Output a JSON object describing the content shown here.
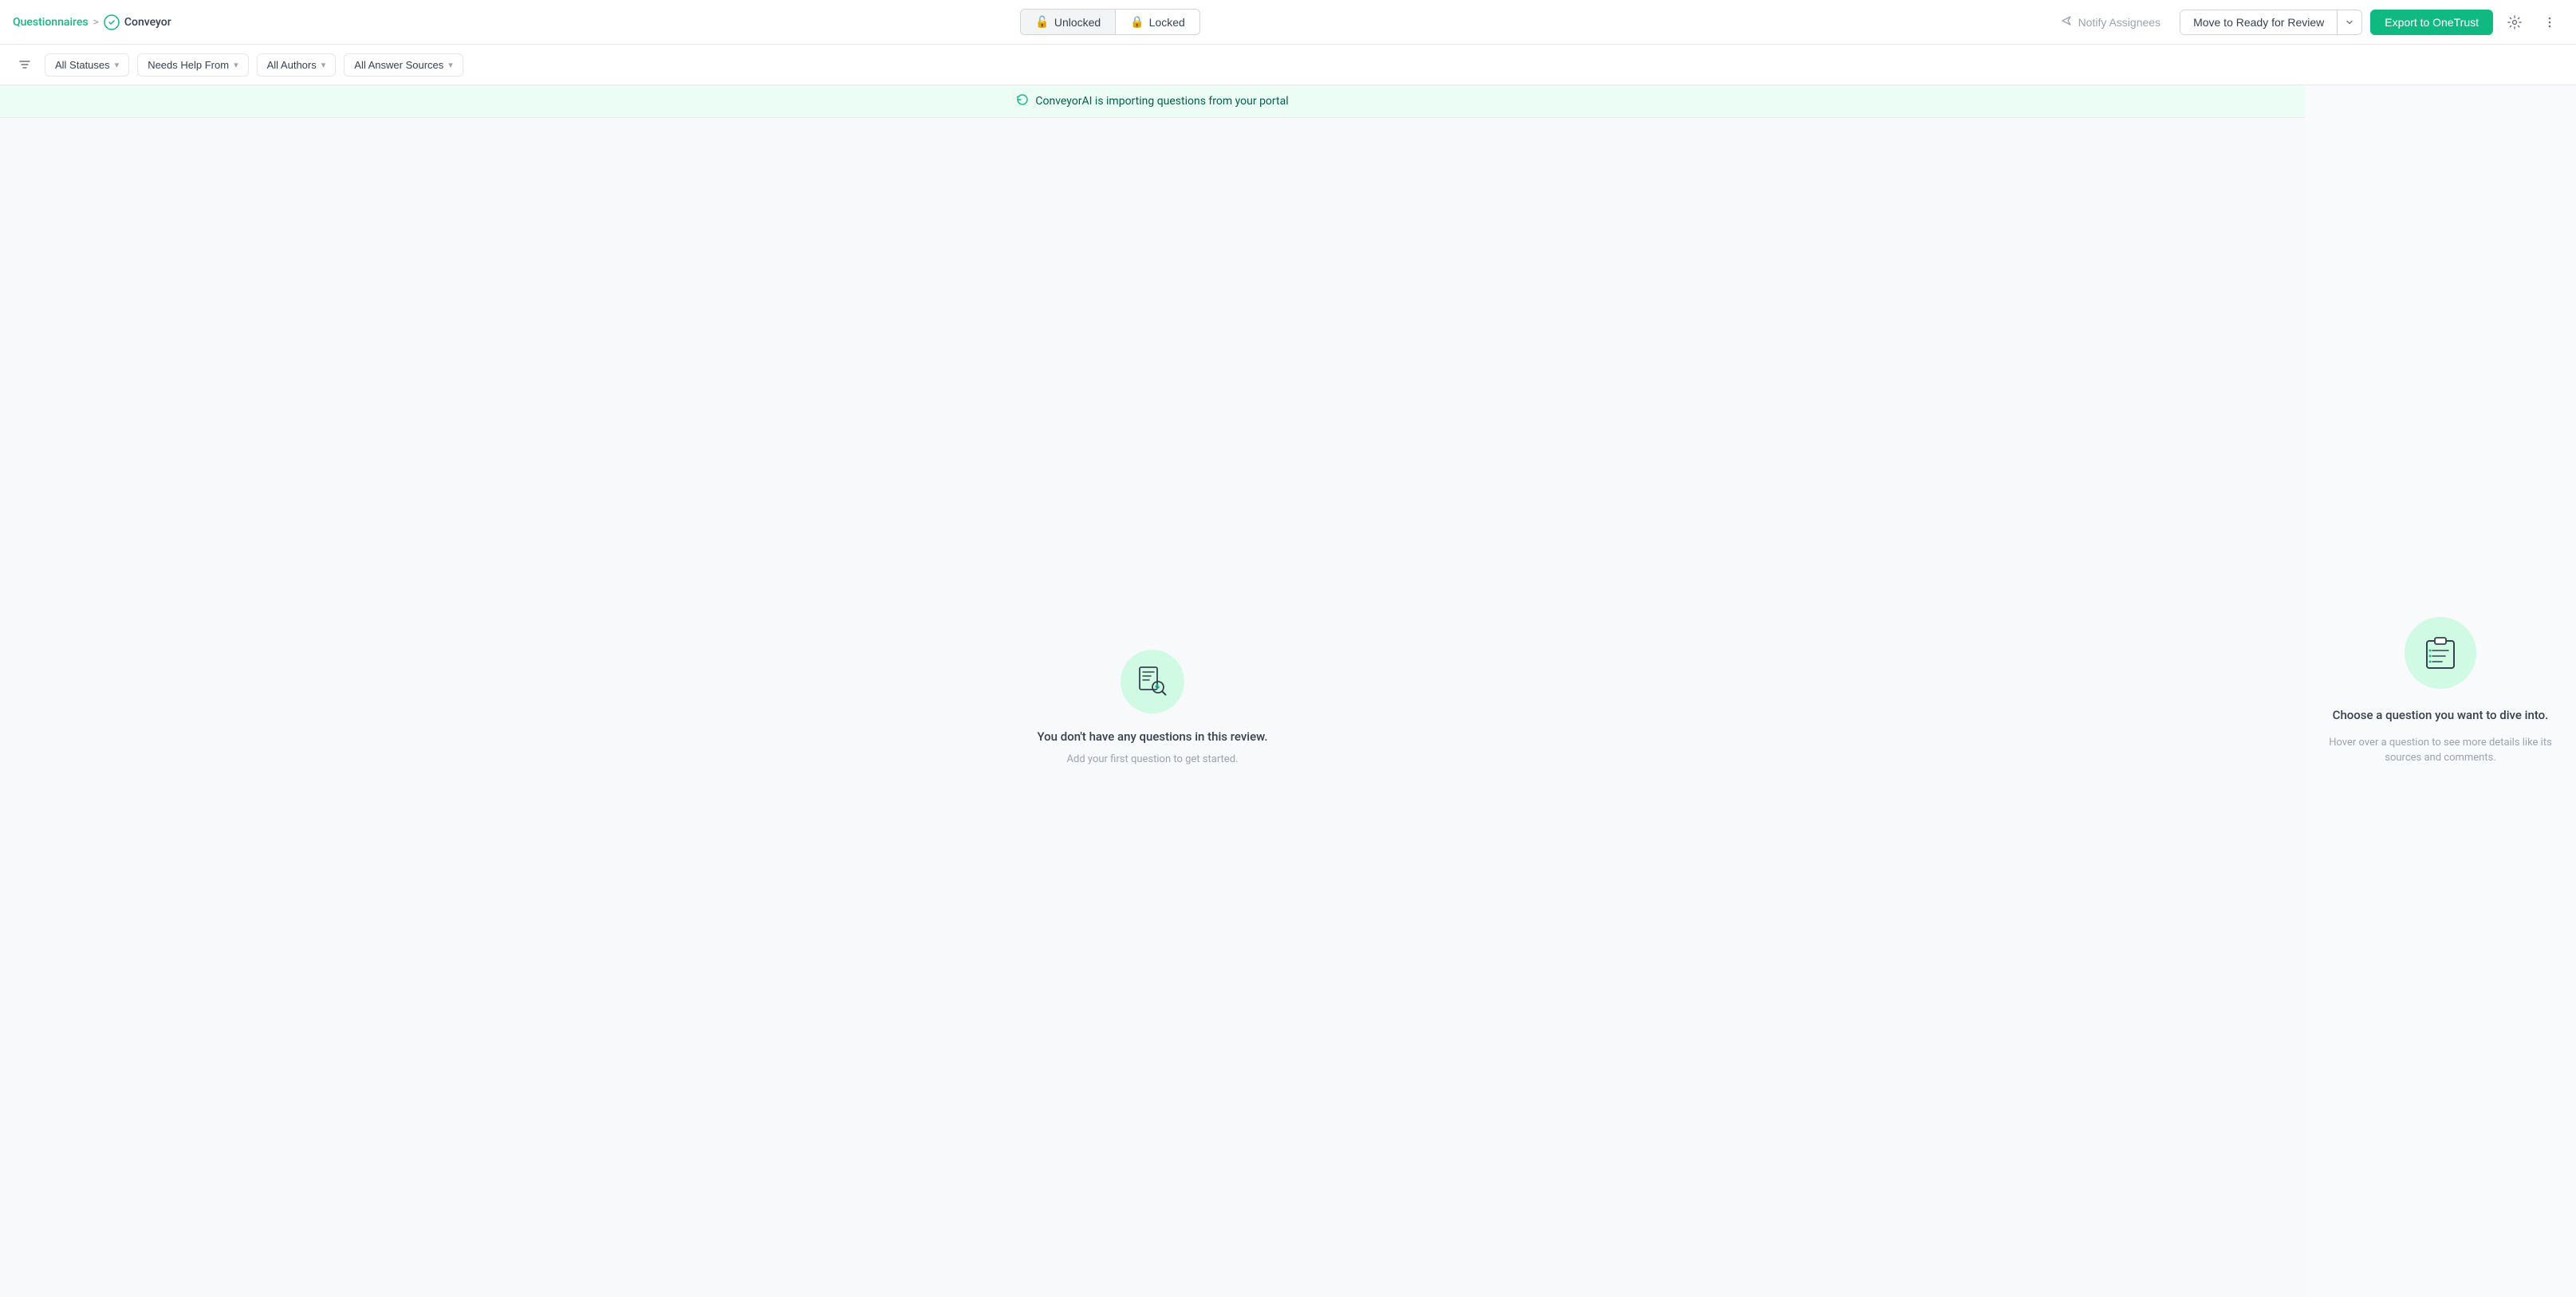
{
  "header": {
    "breadcrumb_link": "Questionnaires",
    "breadcrumb_sep": ">",
    "current_page": "Conveyor",
    "unlock_label": "Unlocked",
    "lock_label": "Locked",
    "notify_label": "Notify Assignees",
    "move_review_label": "Move to Ready for Review",
    "export_label": "Export to OneTrust"
  },
  "filters": {
    "all_statuses": "All Statuses",
    "needs_help": "Needs Help From",
    "all_authors": "All Authors",
    "all_answer_sources": "All Answer Sources"
  },
  "import_banner": {
    "text": "ConveyorAI is importing questions from your portal"
  },
  "empty_state": {
    "title": "You don't have any questions in this review.",
    "subtitle": "Add your first question to get started."
  },
  "side_panel": {
    "title": "Choose a question you want to dive into.",
    "subtitle": "Hover over a question to see more details like its sources and comments."
  },
  "icons": {
    "lock": "🔒",
    "unlock": "🔓",
    "filter": "▼",
    "caret": "▾",
    "notify_plane": "✈",
    "refresh": "↻",
    "gear": "⚙",
    "more": "⋮"
  }
}
